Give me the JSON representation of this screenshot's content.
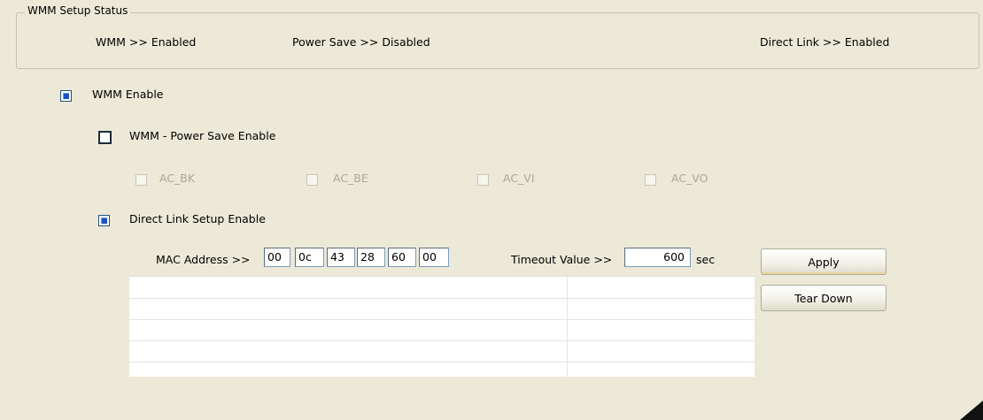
{
  "status_group": {
    "title": "WMM Setup Status",
    "wmm": "WMM >> Enabled",
    "power_save": "Power Save >> Disabled",
    "direct_link": "Direct Link >> Enabled"
  },
  "wmm_enable": {
    "label": "WMM Enable",
    "checked": true
  },
  "power_save_enable": {
    "label": "WMM - Power Save Enable",
    "checked": false
  },
  "ac_options": [
    {
      "label": "AC_BK",
      "checked": false,
      "disabled": true
    },
    {
      "label": "AC_BE",
      "checked": false,
      "disabled": true
    },
    {
      "label": "AC_VI",
      "checked": false,
      "disabled": true
    },
    {
      "label": "AC_VO",
      "checked": false,
      "disabled": true
    }
  ],
  "direct_link_enable": {
    "label": "Direct Link Setup Enable",
    "checked": true
  },
  "mac": {
    "label": "MAC Address >>",
    "octets": [
      "00",
      "0c",
      "43",
      "28",
      "60",
      "00"
    ]
  },
  "timeout": {
    "label": "Timeout Value >>",
    "value": "600",
    "unit": "sec"
  },
  "buttons": {
    "apply": "Apply",
    "tear_down": "Tear Down"
  },
  "dls_table": {
    "columns": [
      "",
      ""
    ],
    "rows": []
  }
}
